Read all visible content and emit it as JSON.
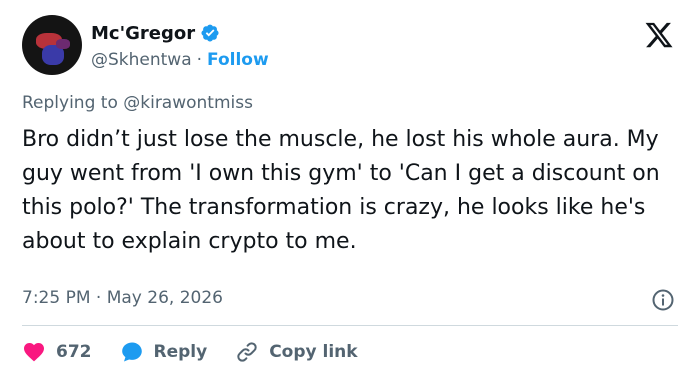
{
  "author": {
    "display_name": "Mc'Gregor",
    "handle": "@Skhentwa",
    "separator": "·",
    "follow_label": "Follow"
  },
  "reply": {
    "prefix": "Replying to ",
    "mention": "@kirawontmiss"
  },
  "tweet": {
    "text": "Bro didn’t just lose the muscle, he lost his whole aura. My guy went from 'I own this gym' to 'Can I get a discount on this polo?' The transformation is crazy, he looks like he's about to explain crypto to me."
  },
  "meta": {
    "time": "7:25 PM",
    "separator": "·",
    "date": "May 26, 2026"
  },
  "actions": {
    "like_count": "672",
    "reply_label": "Reply",
    "copy_link_label": "Copy link"
  },
  "colors": {
    "accent": "#1d9bf0",
    "like": "#f91880",
    "muted": "#536471",
    "text": "#0f1419",
    "divider": "#cfd9de"
  },
  "icons": [
    "verified-badge-icon",
    "x-logo-icon",
    "info-icon",
    "heart-icon",
    "reply-bubble-icon",
    "link-icon"
  ]
}
